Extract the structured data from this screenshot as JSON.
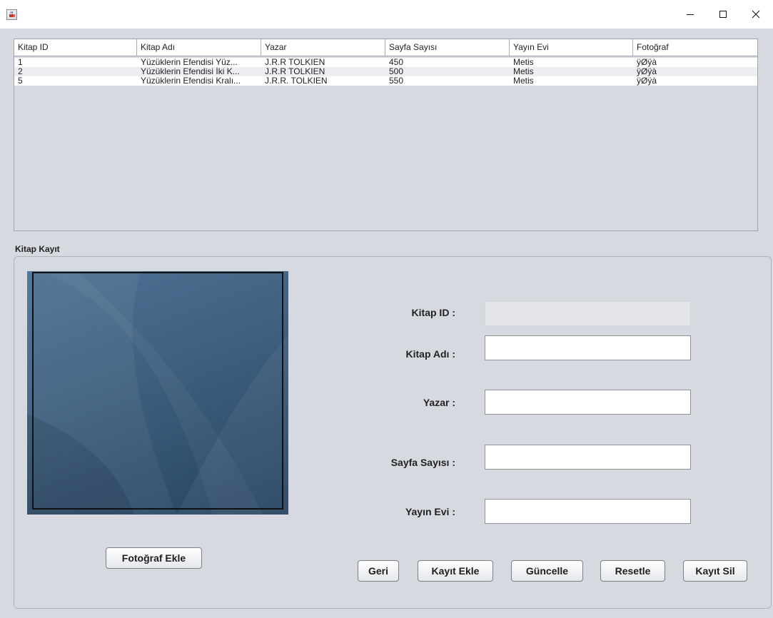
{
  "window": {
    "icon": "java-coffee-icon",
    "controls": [
      "minimize",
      "maximize",
      "close"
    ]
  },
  "table": {
    "columns": [
      "Kitap ID",
      "Kitap Adı",
      "Yazar",
      "Sayfa Sayısı",
      "Yayın Evi",
      "Fotoğraf"
    ],
    "rows": [
      [
        "1",
        "Yüzüklerin Efendisi Yüz...",
        "J.R.R TOLKIEN",
        "450",
        "Metis",
        "ÿØÿà"
      ],
      [
        "2",
        "Yüzüklerin Efendisi İki K...",
        "J.R.R TOLKIEN",
        "500",
        "Metis",
        "ÿØÿà"
      ],
      [
        "5",
        "Yüzüklerin Efendisi Kralı...",
        "J.R.R. TOLKIEN",
        "550",
        "Metis",
        "ÿØÿà"
      ]
    ]
  },
  "form": {
    "section_title": "Kitap Kayıt",
    "fields": [
      {
        "label": "Kitap ID :",
        "value": "",
        "enabled": false
      },
      {
        "label": "Kitap Adı :",
        "value": "",
        "enabled": true
      },
      {
        "label": "Yazar :",
        "value": "",
        "enabled": true
      },
      {
        "label": "Sayfa Sayısı :",
        "value": "",
        "enabled": true
      },
      {
        "label": "Yayın Evi :",
        "value": "",
        "enabled": true
      }
    ],
    "photo_button": "Fotoğraf Ekle",
    "buttons": {
      "back": "Geri",
      "add": "Kayıt Ekle",
      "update": "Güncelle",
      "reset": "Resetle",
      "delete": "Kayıt Sil"
    }
  }
}
